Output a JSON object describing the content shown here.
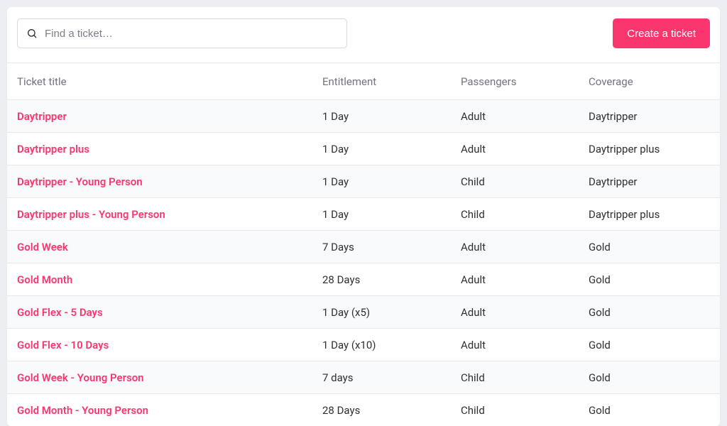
{
  "toolbar": {
    "search_placeholder": "Find a ticket…",
    "create_label": "Create a ticket"
  },
  "columns": {
    "title": "Ticket title",
    "entitlement": "Entitlement",
    "passengers": "Passengers",
    "coverage": "Coverage"
  },
  "rows": [
    {
      "title": "Daytripper",
      "entitlement": "1 Day",
      "passengers": "Adult",
      "coverage": "Daytripper"
    },
    {
      "title": "Daytripper plus",
      "entitlement": "1 Day",
      "passengers": "Adult",
      "coverage": "Daytripper plus"
    },
    {
      "title": "Daytripper - Young Person",
      "entitlement": "1 Day",
      "passengers": "Child",
      "coverage": "Daytripper"
    },
    {
      "title": "Daytripper plus - Young Person",
      "entitlement": "1 Day",
      "passengers": "Child",
      "coverage": "Daytripper plus"
    },
    {
      "title": "Gold Week",
      "entitlement": "7 Days",
      "passengers": "Adult",
      "coverage": "Gold"
    },
    {
      "title": "Gold Month",
      "entitlement": "28 Days",
      "passengers": "Adult",
      "coverage": "Gold"
    },
    {
      "title": "Gold Flex - 5 Days",
      "entitlement": "1 Day (x5)",
      "passengers": "Adult",
      "coverage": "Gold"
    },
    {
      "title": "Gold Flex - 10 Days",
      "entitlement": "1 Day (x10)",
      "passengers": "Adult",
      "coverage": "Gold"
    },
    {
      "title": "Gold Week - Young Person",
      "entitlement": "7 days",
      "passengers": "Child",
      "coverage": "Gold"
    },
    {
      "title": "Gold Month - Young Person",
      "entitlement": "28 Days",
      "passengers": "Child",
      "coverage": "Gold"
    }
  ]
}
